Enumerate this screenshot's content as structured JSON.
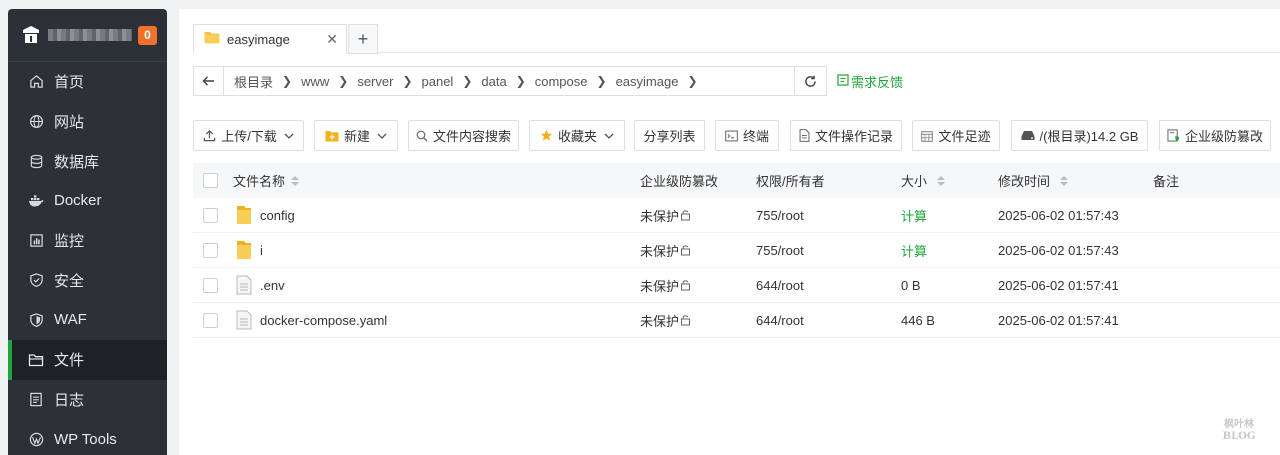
{
  "sidebar": {
    "badge": "0",
    "items": [
      {
        "label": "首页",
        "icon": "home-icon"
      },
      {
        "label": "网站",
        "icon": "globe-icon"
      },
      {
        "label": "数据库",
        "icon": "database-icon"
      },
      {
        "label": "Docker",
        "icon": "docker-icon"
      },
      {
        "label": "监控",
        "icon": "monitor-icon"
      },
      {
        "label": "安全",
        "icon": "shield-icon"
      },
      {
        "label": "WAF",
        "icon": "waf-shield-icon"
      },
      {
        "label": "文件",
        "icon": "folder-icon",
        "active": true
      },
      {
        "label": "日志",
        "icon": "log-icon"
      },
      {
        "label": "WP Tools",
        "icon": "wordpress-icon"
      }
    ]
  },
  "tab": {
    "label": "easyimage"
  },
  "path": {
    "crumbs": [
      "根目录",
      "www",
      "server",
      "panel",
      "data",
      "compose",
      "easyimage"
    ],
    "feedback": "需求反馈"
  },
  "toolbar": {
    "upload": "上传/下载",
    "new": "新建",
    "search": "文件内容搜索",
    "favorites": "收藏夹",
    "share": "分享列表",
    "terminal": "终端",
    "oplog": "文件操作记录",
    "footprint": "文件足迹",
    "disk": "/(根目录)14.2 GB",
    "tamper": "企业级防篡改"
  },
  "table": {
    "headers": {
      "name": "文件名称",
      "tamper": "企业级防篡改",
      "perm": "权限/所有者",
      "size": "大小",
      "mtime": "修改时间",
      "note": "备注"
    },
    "rows": [
      {
        "name": "config",
        "type": "folder",
        "tamper": "未保护",
        "perm": "755/root",
        "size": "计算",
        "mtime": "2025-06-02 01:57:43"
      },
      {
        "name": "i",
        "type": "folder",
        "tamper": "未保护",
        "perm": "755/root",
        "size": "计算",
        "mtime": "2025-06-02 01:57:43"
      },
      {
        "name": ".env",
        "type": "file",
        "tamper": "未保护",
        "perm": "644/root",
        "size": "0 B",
        "mtime": "2025-06-02 01:57:41"
      },
      {
        "name": "docker-compose.yaml",
        "type": "file",
        "tamper": "未保护",
        "perm": "644/root",
        "size": "446 B",
        "mtime": "2025-06-02 01:57:41"
      }
    ]
  },
  "watermark": [
    "枫叶林",
    "BLOG"
  ],
  "colors": {
    "accent": "#20a53a",
    "sidebar": "#2c3138",
    "badge": "#f0712c",
    "folder": "#f5c342"
  }
}
